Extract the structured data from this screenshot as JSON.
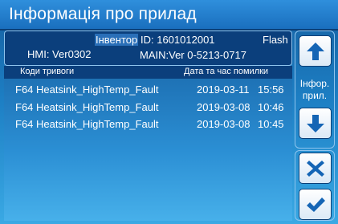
{
  "title": "Інформація про прилад",
  "info": {
    "device_label": "Інвентор",
    "id_text": "ID: 1601012001",
    "flash": "Flash",
    "hmi": "HMI: Ver0302",
    "main": "MAIN:Ver 0-5213-0717"
  },
  "table": {
    "headers": [
      "Коди тривоги",
      "Дата та час помилки"
    ],
    "rows": [
      {
        "code": "F64 Heatsink_HighTemp_Fault",
        "date": "2019-03-11",
        "time": "15:56"
      },
      {
        "code": "F64 Heatsink_HighTemp_Fault",
        "date": "2019-03-08",
        "time": "10:46"
      },
      {
        "code": "F64 Heatsink_HighTemp_Fault",
        "date": "2019-03-08",
        "time": "10:45"
      }
    ]
  },
  "side": {
    "info_label_line1": "Інфор.",
    "info_label_line2": "прил.",
    "buttons": {
      "up": "arrow-up-icon",
      "down": "arrow-down-icon",
      "cancel": "close-icon",
      "confirm": "check-icon"
    }
  },
  "colors": {
    "accent": "#1a6fbe",
    "panel": "#0b3f7c",
    "icon": "#1565b5"
  }
}
